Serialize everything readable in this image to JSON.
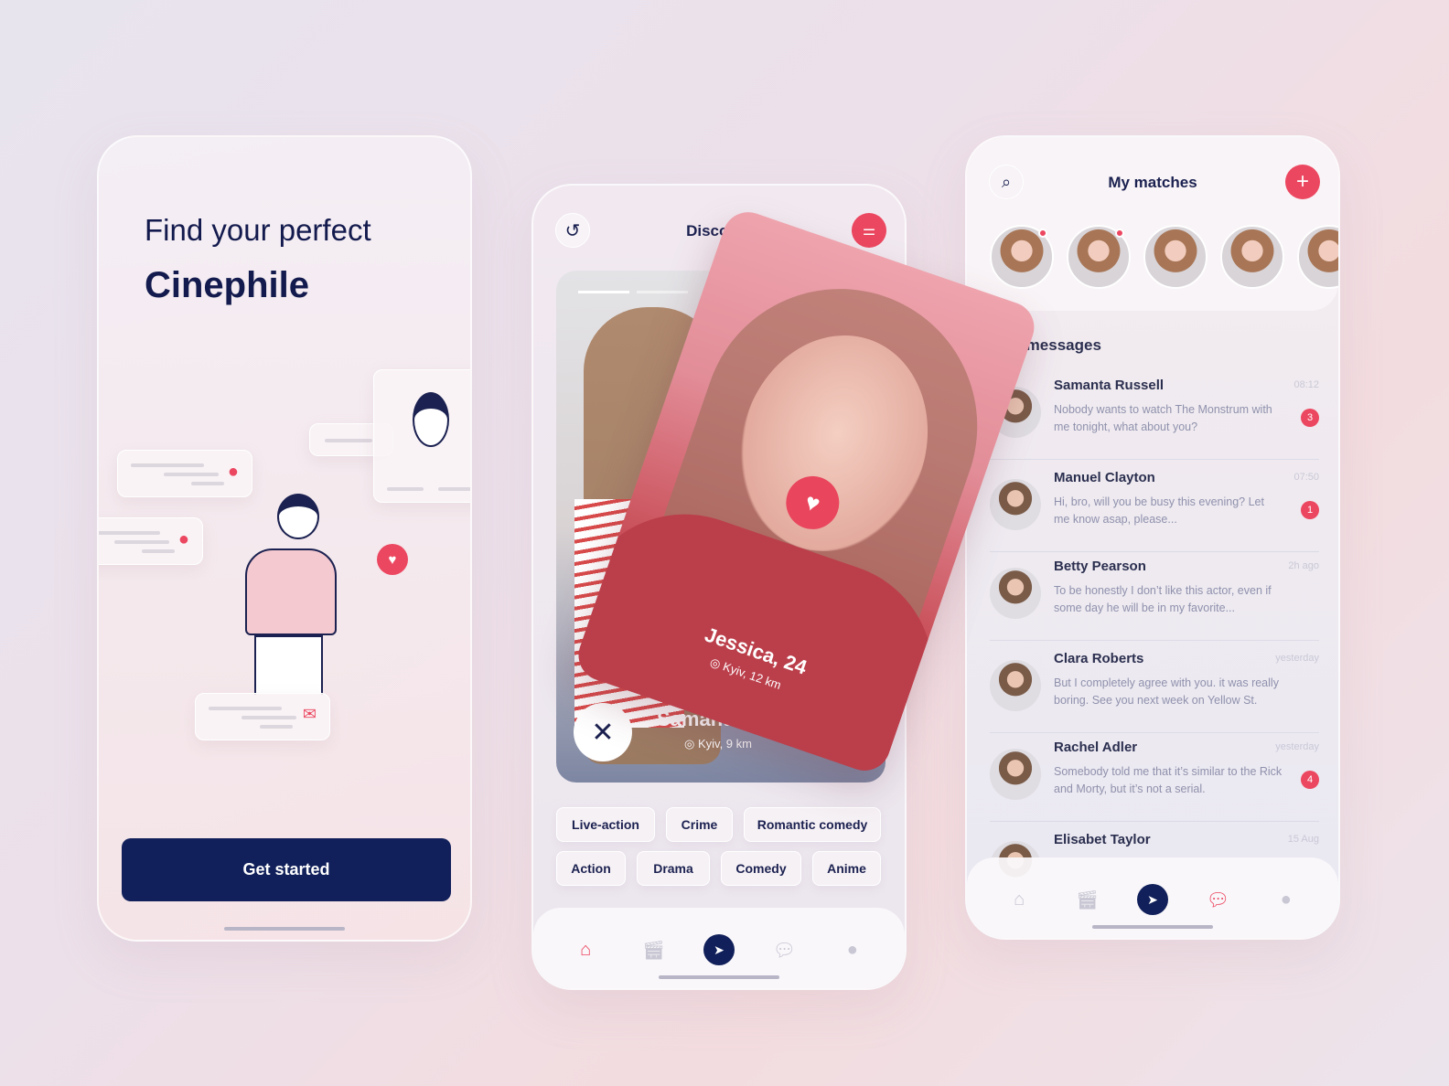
{
  "onboarding": {
    "title_line1": "Find your perfect",
    "title_line2": "Cinephile",
    "cta": "Get started"
  },
  "discover": {
    "title": "Discover",
    "back_card": {
      "name": "Samantha",
      "location": "Kyiv, 9 km"
    },
    "front_card": {
      "name": "Jessica, 24",
      "location": "Kyiv, 12 km"
    },
    "genres": [
      "Live-action",
      "Crime",
      "Romantic comedy",
      "Action",
      "Drama",
      "Comedy",
      "Anime"
    ]
  },
  "matches": {
    "title": "My matches",
    "section": "New messages",
    "messages": [
      {
        "name": "Samanta Russell",
        "text": "Nobody wants to watch The Monstrum with me tonight, what about you?",
        "time": "08:12",
        "unread": "3"
      },
      {
        "name": "Manuel Clayton",
        "text": "Hi, bro, will you be busy this evening? Let me know asap, please...",
        "time": "07:50",
        "unread": "1"
      },
      {
        "name": "Betty Pearson",
        "text": "To be honestly I don’t like this actor, even if some day he will be in my favorite...",
        "time": "2h ago"
      },
      {
        "name": "Clara Roberts",
        "text": "But I completely agree with you. it was really boring. See you next week on Yellow St.",
        "time": "yesterday"
      },
      {
        "name": "Rachel Adler",
        "text": "Somebody told me that it’s similar to the Rick and Morty, but it’s not a serial.",
        "time": "yesterday",
        "unread": "4"
      },
      {
        "name": "Elisabet Taylor",
        "text": "",
        "time": "15 Aug"
      }
    ]
  },
  "colors": {
    "accent": "#ec4760",
    "navy": "#11205a"
  }
}
